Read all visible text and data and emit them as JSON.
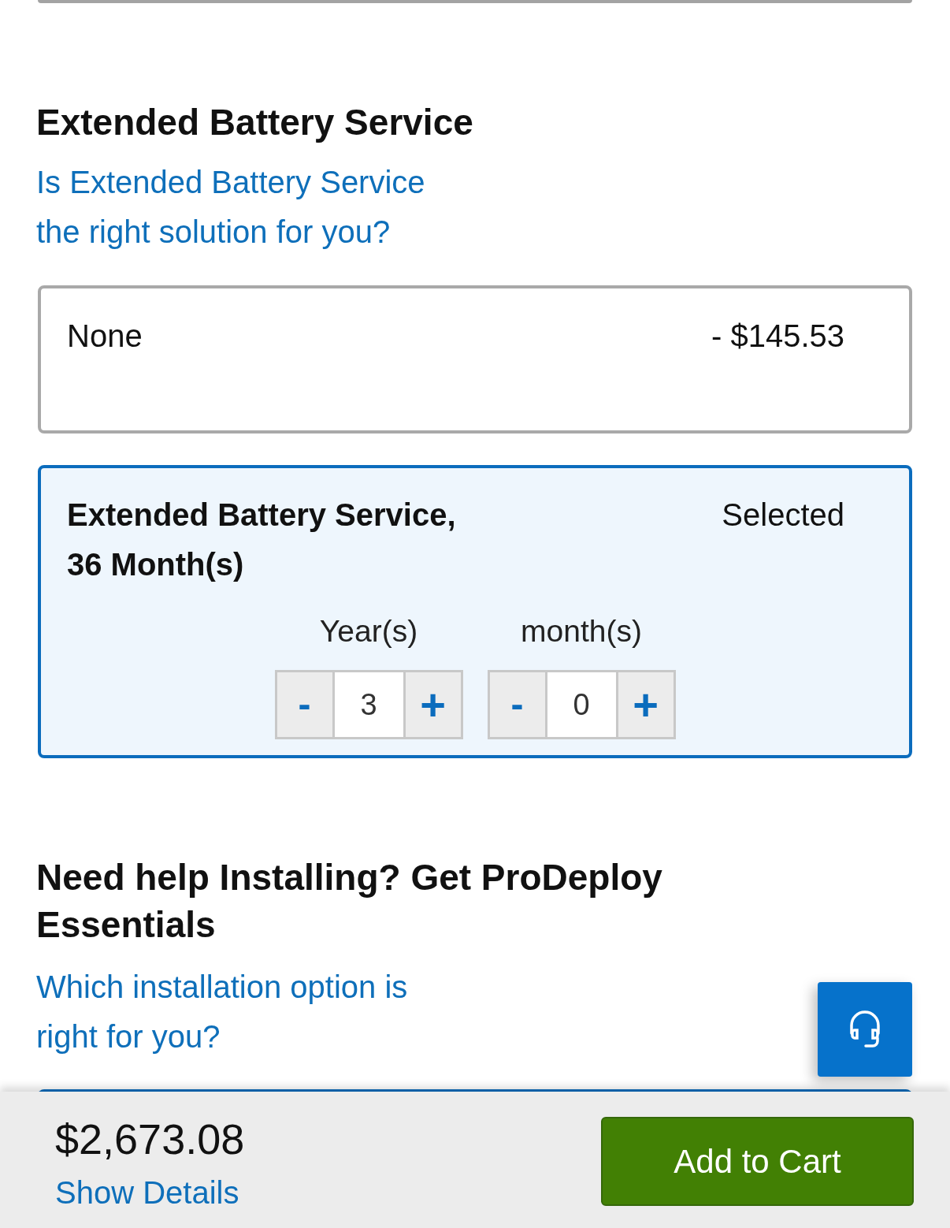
{
  "sections": [
    {
      "heading": "Extended Battery Service",
      "link": "Is Extended Battery Service the right solution for you?",
      "options": [
        {
          "name": "None",
          "price": "- $145.53",
          "selected": false
        },
        {
          "name": "Extended Battery Service, 36 Month(s)",
          "status": "Selected",
          "selected": true,
          "duration": [
            {
              "label": "Year(s)",
              "minus": "-",
              "value": "3",
              "plus": "+"
            },
            {
              "label": "month(s)",
              "minus": "-",
              "value": "0",
              "plus": "+"
            }
          ]
        }
      ]
    },
    {
      "heading": "Need help Installing? Get ProDeploy Essentials",
      "link": "Which installation option is right for you?"
    }
  ],
  "footer": {
    "total": "$2,673.08",
    "details_link": "Show Details",
    "add_to_cart": "Add to Cart"
  }
}
